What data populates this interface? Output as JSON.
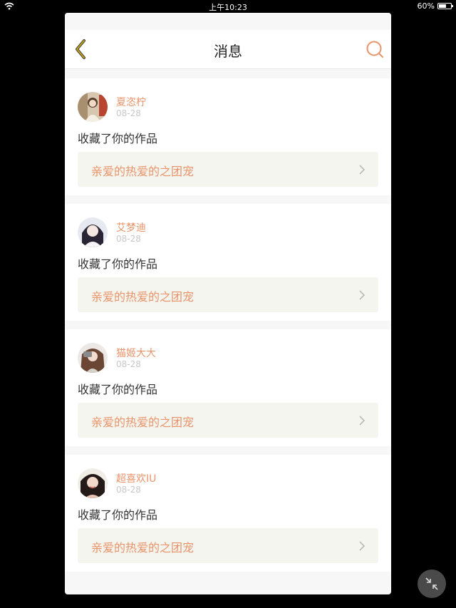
{
  "status_bar": {
    "time": "上午10:23",
    "battery": "60%"
  },
  "header": {
    "title": "消息"
  },
  "messages": [
    {
      "user": "夏恣柠",
      "date": "08-28",
      "action": "收藏了你的作品",
      "work": "亲爱的热爱的之团宠"
    },
    {
      "user": "艾梦迪",
      "date": "08-28",
      "action": "收藏了你的作品",
      "work": "亲爱的热爱的之团宠"
    },
    {
      "user": "猫姬大大",
      "date": "08-28",
      "action": "收藏了你的作品",
      "work": "亲爱的热爱的之团宠"
    },
    {
      "user": "超喜欢IU",
      "date": "08-28",
      "action": "收藏了你的作品",
      "work": "亲爱的热爱的之团宠"
    }
  ],
  "colors": {
    "accent": "#e8936a",
    "back_icon": "#c8a316"
  },
  "icons": {
    "back": "chevron-left-icon",
    "search": "search-icon",
    "floating": "collapse-arrows-icon"
  }
}
